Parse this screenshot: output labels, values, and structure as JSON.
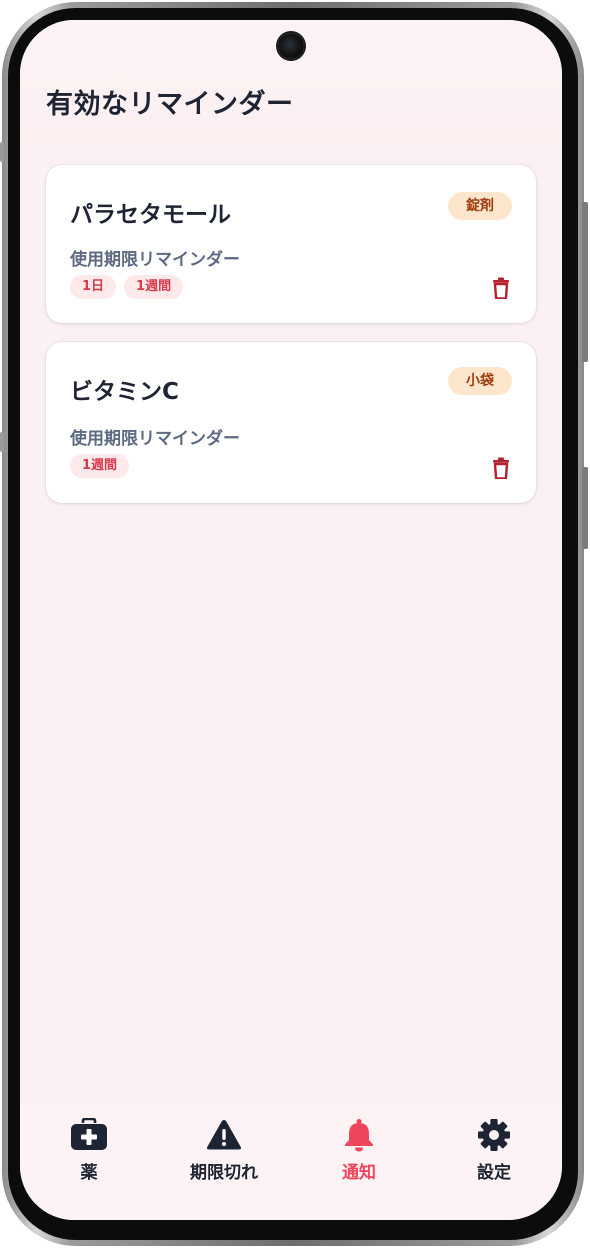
{
  "header": {
    "title": "有効なリマインダー"
  },
  "reminders": [
    {
      "name": "パラセタモール",
      "type": "錠剤",
      "subtitle": "使用期限リマインダー",
      "chips": [
        "1日",
        "1週間"
      ]
    },
    {
      "name": "ビタミンC",
      "type": "小袋",
      "subtitle": "使用期限リマインダー",
      "chips": [
        "1週間"
      ]
    }
  ],
  "nav": {
    "items": [
      {
        "label": "薬",
        "icon": "medicine-kit-icon"
      },
      {
        "label": "期限切れ",
        "icon": "warning-icon"
      },
      {
        "label": "通知",
        "icon": "bell-icon",
        "active": true
      },
      {
        "label": "設定",
        "icon": "gear-icon"
      }
    ]
  },
  "colors": {
    "accent": "#f0465b",
    "badge_bg": "#fde6cc",
    "badge_text": "#a23d0f",
    "chip_bg": "#fde8ea",
    "chip_text": "#d93a4d",
    "trash": "#b3202f",
    "background": "#fcf1f2"
  }
}
